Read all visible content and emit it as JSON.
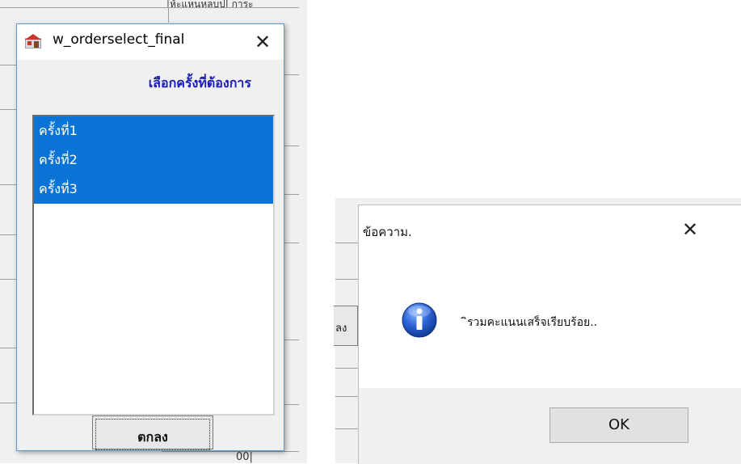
{
  "order_dialog": {
    "title": "w_orderselect_final",
    "close_glyph": "✕",
    "heading": "เลือกครั้งที่ต้องการ",
    "items": [
      "ครั้งที่1",
      "ครั้งที่2",
      "ครั้งที่3"
    ],
    "ok_label": "ตกลง"
  },
  "background": {
    "top_fragment": "|ห้ะแหนหลบป| การะ",
    "bottom_fragment": "00|",
    "left_button_fragment": "ลง"
  },
  "message_dialog": {
    "title": "ข้อความ.",
    "close_glyph": "✕",
    "message": "ิรวมคะแนนเสร็จเรียบร้อย..",
    "ok_label": "OK"
  },
  "colors": {
    "selection": "#0a74d6",
    "heading": "#1a1ab8",
    "dialog_border": "#5a9bd5"
  },
  "icons": {
    "app_icon": "app-window-icon",
    "info_icon": "information-icon"
  }
}
